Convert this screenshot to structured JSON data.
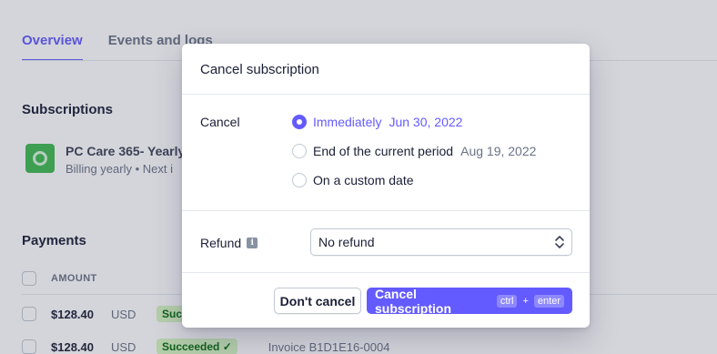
{
  "tabs": [
    {
      "label": "Overview",
      "active": true
    },
    {
      "label": "Events and logs",
      "active": false
    }
  ],
  "subscriptions": {
    "title": "Subscriptions",
    "item": {
      "name": "PC Care 365- Yearly",
      "meta": "Billing yearly • Next i"
    }
  },
  "payments": {
    "title": "Payments",
    "column_amount": "AMOUNT",
    "rows": [
      {
        "amount": "$128.40",
        "currency": "USD",
        "status": "Succee",
        "invoice": ""
      },
      {
        "amount": "$128.40",
        "currency": "USD",
        "status": "Succeeded ✓",
        "invoice": "Invoice B1D1E16-0004"
      }
    ]
  },
  "modal": {
    "title": "Cancel subscription",
    "cancel_label": "Cancel",
    "options": [
      {
        "label": "Immediately",
        "date": "Jun 30, 2022",
        "selected": true
      },
      {
        "label": "End of the current period",
        "date": "Aug 19, 2022",
        "selected": false
      },
      {
        "label": "On a custom date",
        "date": "",
        "selected": false
      }
    ],
    "refund_label": "Refund",
    "refund_value": "No refund",
    "dont_cancel": "Don't cancel",
    "confirm": "Cancel subscription",
    "shortcut_key1": "ctrl",
    "shortcut_plus": "+",
    "shortcut_key2": "enter"
  },
  "colors": {
    "accent": "#635bff",
    "success_bg": "#d7f7c2",
    "success_text": "#05690d"
  }
}
